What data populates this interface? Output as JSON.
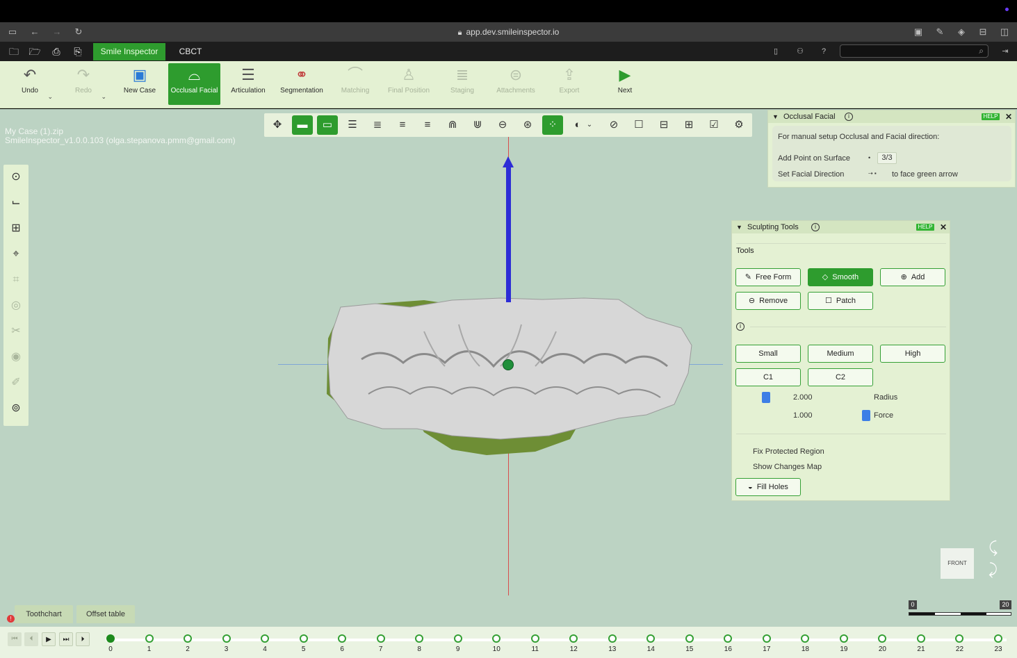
{
  "browser": {
    "url": "app.dev.smileinspector.io"
  },
  "appbar": {
    "tab_main": "Smile Inspector",
    "tab_cbct": "CBCT"
  },
  "toolbar": {
    "undo": "Undo",
    "redo": "Redo",
    "new_case": "New Case",
    "occlusal_facial": "Occlusal Facial",
    "articulation": "Articulation",
    "segmentation": "Segmentation",
    "matching": "Matching",
    "final_position": "Final Position",
    "staging": "Staging",
    "attachments": "Attachments",
    "export": "Export",
    "next": "Next"
  },
  "case": {
    "file": "My Case (1).zip",
    "version": "SmileInspector_v1.0.0.103 (olga.stepanova.pmm@gmail.com)"
  },
  "occlusal_panel": {
    "title": "Occlusal Facial",
    "help": "HELP",
    "intro": "For manual setup Occlusal and Facial direction:",
    "row1_label": "Add Point on Surface",
    "row1_value": "3/3",
    "row2_label": "Set Facial Direction",
    "row2_value": "to face green arrow"
  },
  "sculpt_panel": {
    "title": "Sculpting Tools",
    "help": "HELP",
    "tools_label": "Tools",
    "free_form": "Free Form",
    "smooth": "Smooth",
    "add": "Add",
    "remove": "Remove",
    "patch": "Patch",
    "small": "Small",
    "medium": "Medium",
    "high": "High",
    "c1": "C1",
    "c2": "C2",
    "radius_value": "2.000",
    "radius_label": "Radius",
    "force_value": "1.000",
    "force_label": "Force",
    "fix_protected": "Fix Protected Region",
    "show_changes": "Show Changes Map",
    "fill_holes": "Fill Holes"
  },
  "navcube": {
    "label": "FRONT"
  },
  "bottom": {
    "toothchart": "Toothchart",
    "offset_table": "Offset table",
    "scale_min": "0",
    "scale_max": "20"
  },
  "timeline": {
    "current_step": 0,
    "steps": [
      "0",
      "1",
      "2",
      "3",
      "4",
      "5",
      "6",
      "7",
      "8",
      "9",
      "10",
      "11",
      "12",
      "13",
      "14",
      "15",
      "16",
      "17",
      "18",
      "19",
      "20",
      "21",
      "22",
      "23"
    ]
  }
}
